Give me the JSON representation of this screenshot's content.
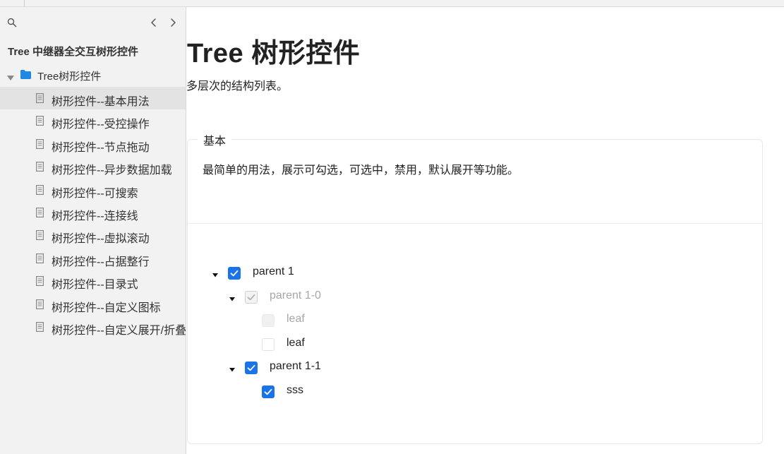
{
  "sidebar": {
    "title": "Tree 中继器全交互树形控件",
    "folder": {
      "label": "Tree树形控件",
      "expanded": true
    },
    "pages": [
      {
        "label": "树形控件--基本用法",
        "active": true
      },
      {
        "label": "树形控件--受控操作",
        "active": false
      },
      {
        "label": "树形控件--节点拖动",
        "active": false
      },
      {
        "label": "树形控件--异步数据加载",
        "active": false
      },
      {
        "label": "树形控件--可搜索",
        "active": false
      },
      {
        "label": "树形控件--连接线",
        "active": false
      },
      {
        "label": "树形控件--虚拟滚动",
        "active": false
      },
      {
        "label": "树形控件--占据整行",
        "active": false
      },
      {
        "label": "树形控件--目录式",
        "active": false
      },
      {
        "label": "树形控件--自定义图标",
        "active": false
      },
      {
        "label": "树形控件--自定义展开/折叠",
        "active": false
      }
    ]
  },
  "main": {
    "title": "Tree 树形控件",
    "description": "多层次的结构列表。",
    "demo": {
      "legend": "基本",
      "description": "最简单的用法，展示可勾选，可选中，禁用，默认展开等功能。",
      "tree": [
        {
          "label": "parent 1",
          "level": 0,
          "expandable": true,
          "expanded": true,
          "checked": true,
          "disabled": false
        },
        {
          "label": "parent 1-0",
          "level": 1,
          "expandable": true,
          "expanded": true,
          "checked": true,
          "disabled": true
        },
        {
          "label": "leaf",
          "level": 2,
          "expandable": false,
          "checked": false,
          "disabled": true
        },
        {
          "label": "leaf",
          "level": 2,
          "expandable": false,
          "checked": false,
          "disabled": false
        },
        {
          "label": "parent 1-1",
          "level": 1,
          "expandable": true,
          "expanded": true,
          "checked": true,
          "disabled": false
        },
        {
          "label": "sss",
          "level": 2,
          "expandable": false,
          "checked": true,
          "disabled": false
        }
      ]
    }
  },
  "colors": {
    "accent": "#1a73e8",
    "sidebar_bg": "#f2f2f2",
    "active_item_bg": "#e3e3e3",
    "folder_icon": "#1e88e5",
    "disabled_text": "#a6a6a6"
  }
}
